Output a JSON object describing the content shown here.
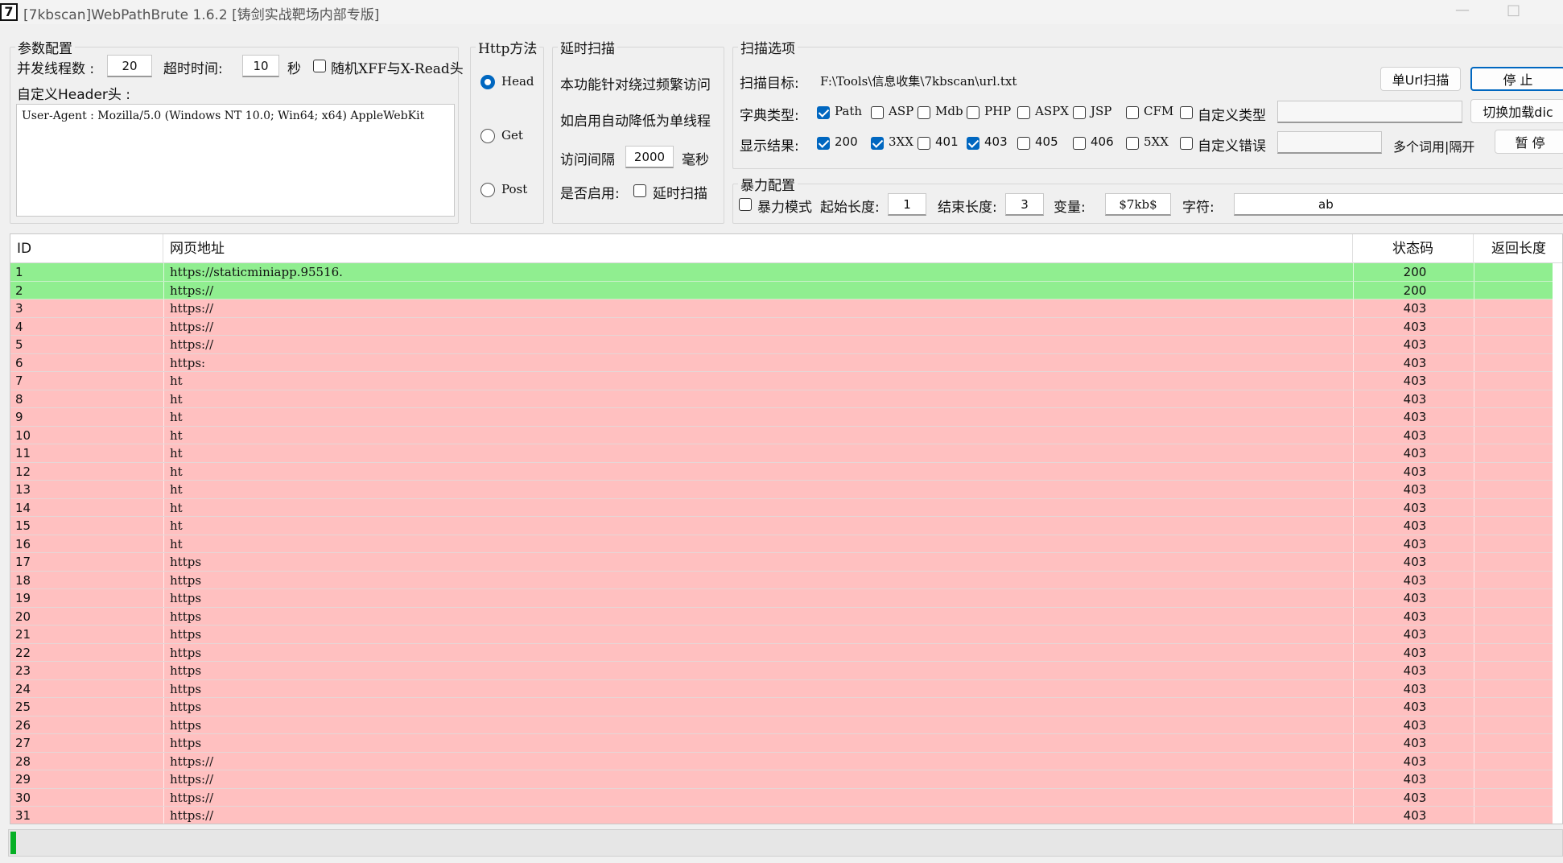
{
  "window": {
    "icon_text": "7",
    "title": "[7kbscan]WebPathBrute 1.6.2 [铸剑实战靶场内部专版]",
    "minimize_glyph": "—",
    "maximize_glyph": "□"
  },
  "params": {
    "group_title": "参数配置",
    "threads_label": "并发线程数 :",
    "threads_value": "20",
    "timeout_label": "超时时间:",
    "timeout_value": "10",
    "timeout_unit": "秒",
    "random_xff_label": "随机XFF与X-Read头",
    "random_xff_checked": false,
    "custom_header_label": "自定义Header头 :",
    "header_value": "User-Agent : Mozilla/5.0 (Windows NT 10.0; Win64; x64) AppleWebKit"
  },
  "http": {
    "group_title": "Http方法",
    "options": [
      {
        "label": "Head",
        "selected": true
      },
      {
        "label": "Get",
        "selected": false
      },
      {
        "label": "Post",
        "selected": false
      }
    ]
  },
  "delay": {
    "group_title": "延时扫描",
    "desc1": "本功能针对绕过频繁访问",
    "desc2": "如启用自动降低为单线程",
    "interval_label": "访问间隔",
    "interval_value": "2000",
    "interval_unit": "毫秒",
    "enable_label": "是否启用:",
    "enable_cb_label": "延时扫描",
    "enabled": false
  },
  "scan": {
    "group_title": "扫描选项",
    "target_label": "扫描目标:",
    "target_value": "F:\\Tools\\信息收集\\7kbscan\\url.txt",
    "single_button": "单Url扫描",
    "stop_button": "停 止",
    "dict_label": "字典类型:",
    "dict_types": [
      {
        "label": "Path",
        "checked": true
      },
      {
        "label": "ASP",
        "checked": false
      },
      {
        "label": "Mdb",
        "checked": false
      },
      {
        "label": "PHP",
        "checked": false
      },
      {
        "label": "ASPX",
        "checked": false
      },
      {
        "label": "JSP",
        "checked": false
      },
      {
        "label": "CFM",
        "checked": false
      },
      {
        "label": "自定义类型",
        "checked": false
      }
    ],
    "switch_button": "切换加载dic",
    "result_label": "显示结果:",
    "result_codes": [
      {
        "label": "200",
        "checked": true
      },
      {
        "label": "3XX",
        "checked": true
      },
      {
        "label": "401",
        "checked": false
      },
      {
        "label": "403",
        "checked": true
      },
      {
        "label": "405",
        "checked": false
      },
      {
        "label": "406",
        "checked": false
      },
      {
        "label": "5XX",
        "checked": false
      },
      {
        "label": "自定义错误",
        "checked": false
      }
    ],
    "multi_hint": "多个词用|隔开",
    "pause_button": "暂 停"
  },
  "brute": {
    "group_title": "暴力配置",
    "mode_label": "暴力模式",
    "mode_checked": false,
    "start_label": "起始长度:",
    "start_value": "1",
    "end_label": "结束长度:",
    "end_value": "3",
    "var_label": "变量:",
    "var_value": "$7kb$",
    "chars_label": "字符:",
    "chars_value": "ab"
  },
  "table": {
    "columns": [
      "ID",
      "网页地址",
      "状态码",
      "返回长度"
    ],
    "rows": [
      {
        "id": "1",
        "url": "https://staticminiapp.95516.",
        "code": "200"
      },
      {
        "id": "2",
        "url": "https://",
        "code": "200"
      },
      {
        "id": "3",
        "url": "https://",
        "code": "403"
      },
      {
        "id": "4",
        "url": "https://",
        "code": "403"
      },
      {
        "id": "5",
        "url": "https://",
        "code": "403"
      },
      {
        "id": "6",
        "url": "https:",
        "code": "403"
      },
      {
        "id": "7",
        "url": "ht",
        "code": "403"
      },
      {
        "id": "8",
        "url": "ht",
        "code": "403"
      },
      {
        "id": "9",
        "url": "ht",
        "code": "403"
      },
      {
        "id": "10",
        "url": "ht",
        "code": "403"
      },
      {
        "id": "11",
        "url": "ht",
        "code": "403"
      },
      {
        "id": "12",
        "url": "ht",
        "code": "403"
      },
      {
        "id": "13",
        "url": "ht",
        "code": "403"
      },
      {
        "id": "14",
        "url": "ht",
        "code": "403"
      },
      {
        "id": "15",
        "url": "ht",
        "code": "403"
      },
      {
        "id": "16",
        "url": "ht",
        "code": "403"
      },
      {
        "id": "17",
        "url": "https",
        "code": "403"
      },
      {
        "id": "18",
        "url": "https",
        "code": "403"
      },
      {
        "id": "19",
        "url": "https",
        "code": "403"
      },
      {
        "id": "20",
        "url": "https",
        "code": "403"
      },
      {
        "id": "21",
        "url": "https",
        "code": "403"
      },
      {
        "id": "22",
        "url": "https",
        "code": "403"
      },
      {
        "id": "23",
        "url": "https",
        "code": "403"
      },
      {
        "id": "24",
        "url": "https",
        "code": "403"
      },
      {
        "id": "25",
        "url": "https",
        "code": "403"
      },
      {
        "id": "26",
        "url": "https",
        "code": "403"
      },
      {
        "id": "27",
        "url": "https",
        "code": "403"
      },
      {
        "id": "28",
        "url": "https://",
        "code": "403"
      },
      {
        "id": "29",
        "url": "https://",
        "code": "403"
      },
      {
        "id": "30",
        "url": "https://",
        "code": "403"
      },
      {
        "id": "31",
        "url": "https://",
        "code": "403"
      }
    ]
  },
  "colors": {
    "row_200": "#90ee90",
    "row_403": "#ffc0c0",
    "accent": "#0067c0",
    "progress": "#06b025"
  },
  "status": {
    "progress_fraction": 0.004
  }
}
